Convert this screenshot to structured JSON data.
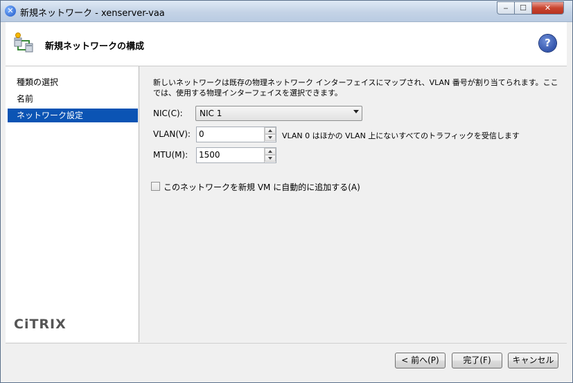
{
  "window": {
    "title": "新規ネットワーク - xenserver-vaa",
    "controls": {
      "minimize": "‒",
      "maximize": "☐",
      "close": "✕"
    }
  },
  "header": {
    "title": "新規ネットワークの構成",
    "help": "?"
  },
  "sidebar": {
    "items": [
      {
        "label": "種類の選択",
        "selected": false
      },
      {
        "label": "名前",
        "selected": false
      },
      {
        "label": "ネットワーク設定",
        "selected": true
      }
    ],
    "brand": "CiTRIX"
  },
  "content": {
    "description": "新しいネットワークは既存の物理ネットワーク インターフェイスにマップされ、VLAN 番号が割り当てられます。ここでは、使用する物理インターフェイスを選択できます。",
    "nic": {
      "label": "NIC(C):",
      "value": "NIC 1"
    },
    "vlan": {
      "label": "VLAN(V):",
      "value": "0",
      "hint": "VLAN 0 はほかの VLAN 上にないすべてのトラフィックを受信します"
    },
    "mtu": {
      "label": "MTU(M):",
      "value": "1500"
    },
    "auto_add": {
      "label": "このネットワークを新規 VM に自動的に追加する(A)",
      "checked": false
    }
  },
  "footer": {
    "back": "< 前へ(P)",
    "finish": "完了(F)",
    "cancel": "キャンセル"
  },
  "colors": {
    "selection": "#0b54b4",
    "help_icon": "#1b3d9a"
  }
}
